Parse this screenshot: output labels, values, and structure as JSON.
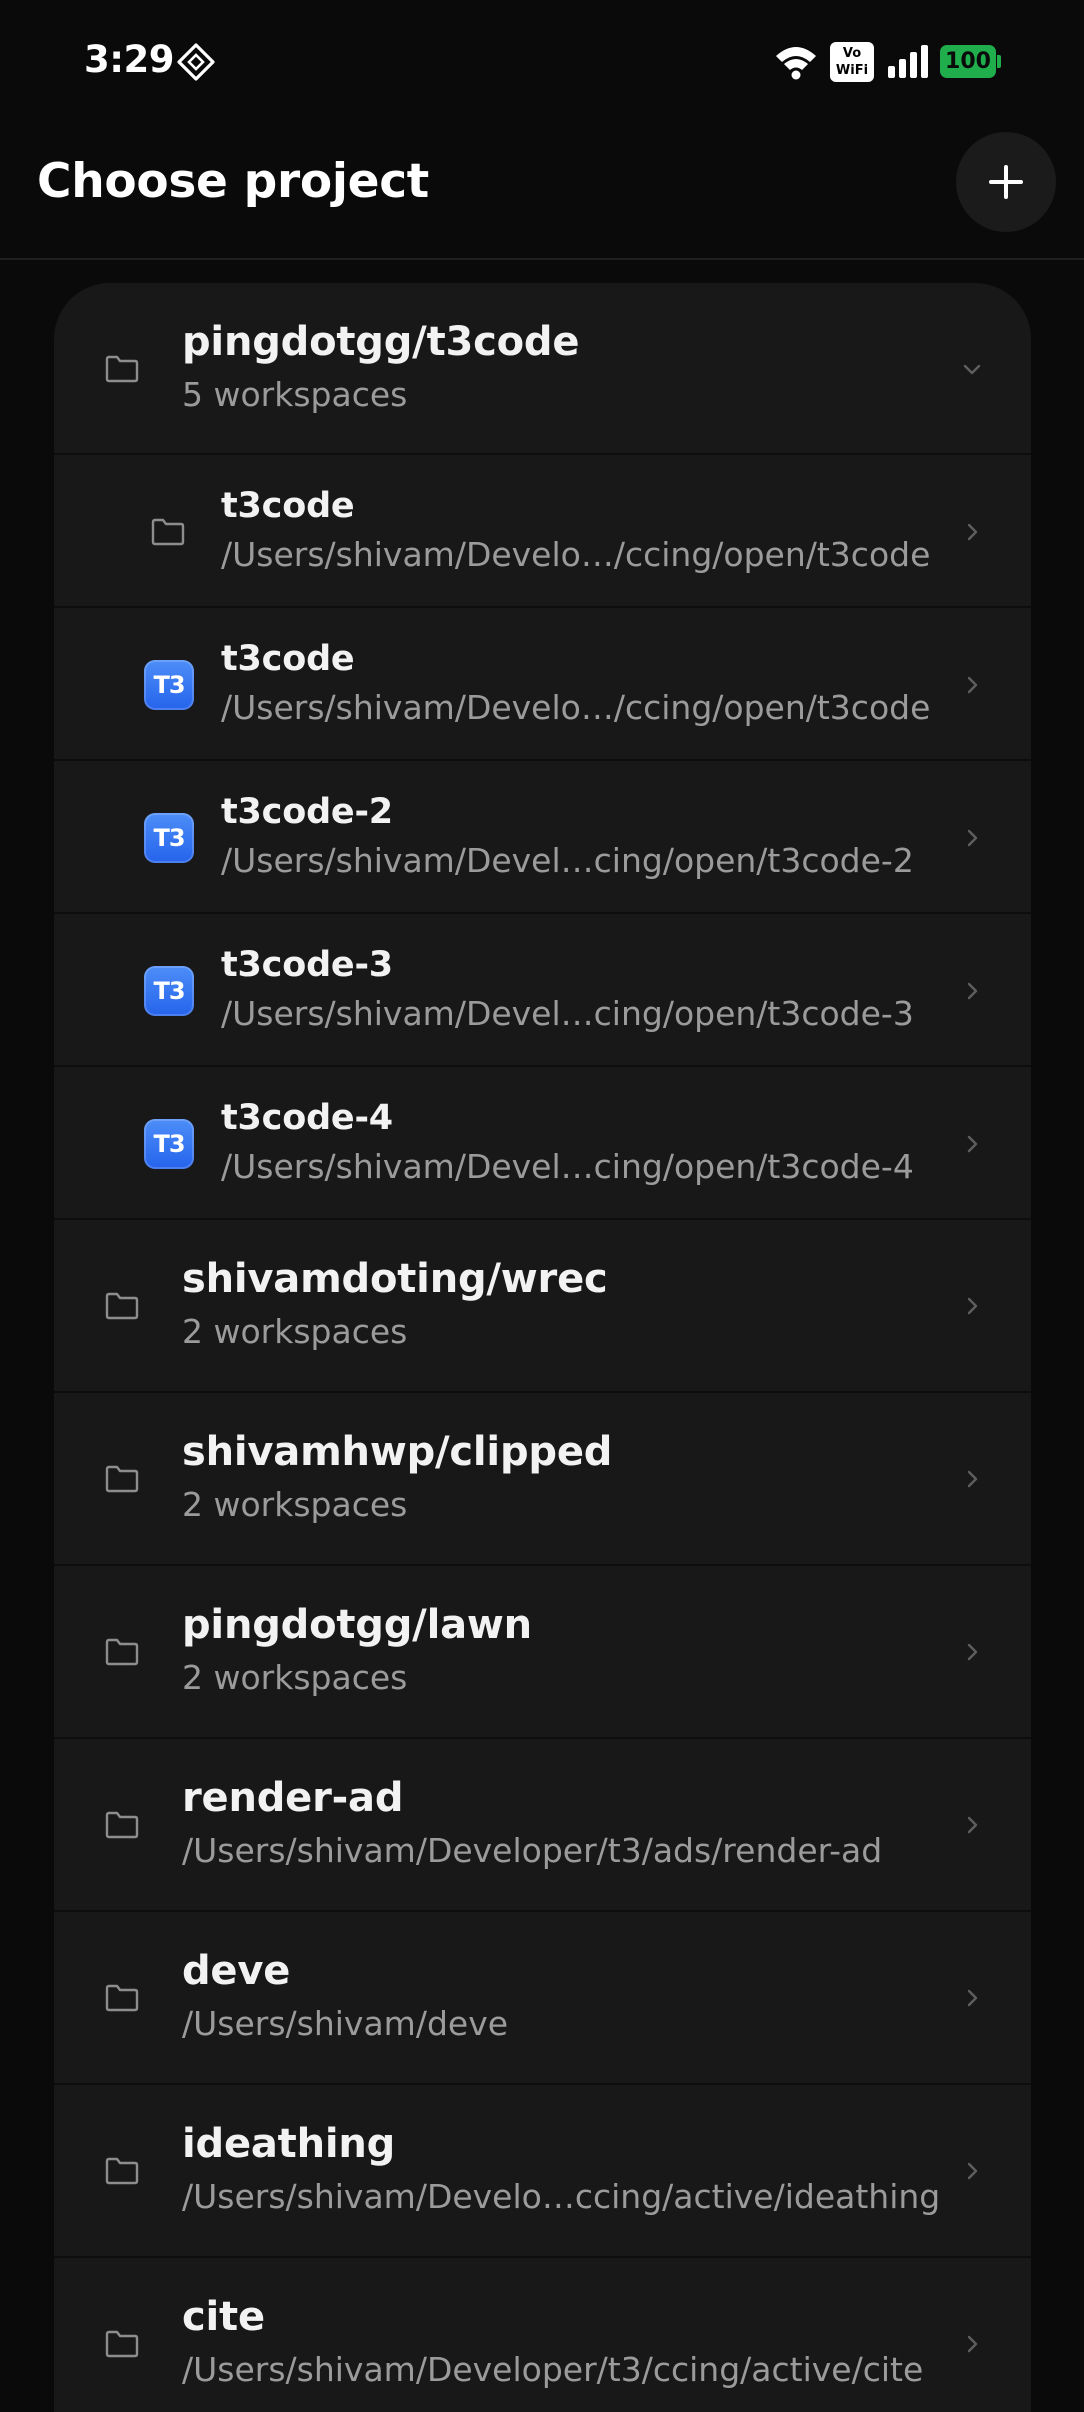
{
  "status_bar": {
    "time": "3:29",
    "vowifi_top": "Vo",
    "vowifi_bottom": "WiFi",
    "battery": "100",
    "battery_color": "#1fae4b"
  },
  "header": {
    "title": "Choose project",
    "add_icon": "plus-icon"
  },
  "groups": [
    {
      "title": "pingdotgg/t3code",
      "subtitle": "5 workspaces",
      "expanded": true,
      "workspaces": [
        {
          "icon": "folder-icon",
          "title": "t3code",
          "path": "/Users/shivam/Develo…/ccing/open/t3code"
        },
        {
          "icon": "t3-icon",
          "badge": "T3",
          "title": "t3code",
          "path": "/Users/shivam/Develo…/ccing/open/t3code"
        },
        {
          "icon": "t3-icon",
          "badge": "T3",
          "title": "t3code-2",
          "path": "/Users/shivam/Devel…cing/open/t3code-2"
        },
        {
          "icon": "t3-icon",
          "badge": "T3",
          "title": "t3code-3",
          "path": "/Users/shivam/Devel…cing/open/t3code-3"
        },
        {
          "icon": "t3-icon",
          "badge": "T3",
          "title": "t3code-4",
          "path": "/Users/shivam/Devel…cing/open/t3code-4"
        }
      ]
    }
  ],
  "projects": [
    {
      "title": "shivamdoting/wrec",
      "subtitle": "2 workspaces"
    },
    {
      "title": "shivamhwp/clipped",
      "subtitle": "2 workspaces"
    },
    {
      "title": "pingdotgg/lawn",
      "subtitle": "2 workspaces"
    },
    {
      "title": "render-ad",
      "subtitle": "/Users/shivam/Developer/t3/ads/render-ad"
    },
    {
      "title": "deve",
      "subtitle": "/Users/shivam/deve"
    },
    {
      "title": "ideathing",
      "subtitle": "/Users/shivam/Develo…ccing/active/ideathing"
    },
    {
      "title": "cite",
      "subtitle": "/Users/shivam/Developer/t3/ccing/active/cite"
    }
  ]
}
